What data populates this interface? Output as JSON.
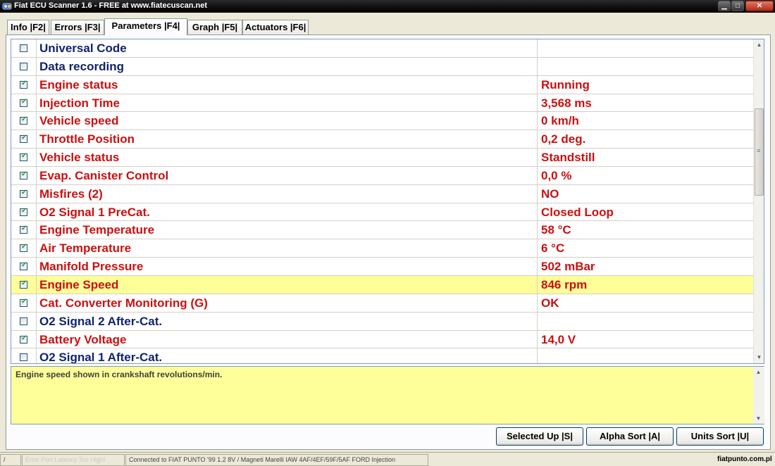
{
  "window": {
    "title": "Fiat ECU Scanner 1.6 - FREE at www.fiatecuscan.net",
    "min_glyph": "▁",
    "max_glyph": "□",
    "close_glyph": "✕"
  },
  "tabs": [
    {
      "label": "Info |F2|",
      "active": false
    },
    {
      "label": "Errors |F3|",
      "active": false
    },
    {
      "label": "Parameters |F4|",
      "active": true
    },
    {
      "label": "Graph |F5|",
      "active": false
    },
    {
      "label": "Actuators |F6|",
      "active": false
    }
  ],
  "parameters": [
    {
      "checked": false,
      "name": "Universal Code",
      "value": ""
    },
    {
      "checked": false,
      "name": "Data recording",
      "value": ""
    },
    {
      "checked": true,
      "name": "Engine status",
      "value": "Running"
    },
    {
      "checked": true,
      "name": "Injection Time",
      "value": "3,568 ms"
    },
    {
      "checked": true,
      "name": "Vehicle speed",
      "value": "0 km/h"
    },
    {
      "checked": true,
      "name": "Throttle Position",
      "value": "0,2 deg."
    },
    {
      "checked": true,
      "name": "Vehicle status",
      "value": "Standstill"
    },
    {
      "checked": true,
      "name": "Evap. Canister Control",
      "value": "0,0 %"
    },
    {
      "checked": true,
      "name": "Misfires (2)",
      "value": "NO"
    },
    {
      "checked": true,
      "name": "O2 Signal 1 PreCat.",
      "value": "Closed Loop"
    },
    {
      "checked": true,
      "name": "Engine Temperature",
      "value": "58 °C"
    },
    {
      "checked": true,
      "name": "Air Temperature",
      "value": "6 °C"
    },
    {
      "checked": true,
      "name": "Manifold Pressure",
      "value": "502 mBar"
    },
    {
      "checked": true,
      "name": "Engine Speed",
      "value": "846 rpm",
      "selected": true
    },
    {
      "checked": true,
      "name": "Cat. Converter Monitoring (G)",
      "value": "OK"
    },
    {
      "checked": false,
      "name": "O2 Signal 2 After-Cat.",
      "value": ""
    },
    {
      "checked": true,
      "name": "Battery Voltage",
      "value": "14,0 V"
    },
    {
      "checked": false,
      "name": "O2 Signal 1 After-Cat.",
      "value": ""
    }
  ],
  "description": "Engine speed shown in crankshaft revolutions/min.",
  "buttons": {
    "selected_up": "Selected Up |S|",
    "alpha_sort": "Alpha Sort |A|",
    "units_sort": "Units Sort |U|"
  },
  "statusbar": {
    "panel1": "/",
    "panel2": "Error Port Latency Too High!",
    "panel3": "Connected to FIAT PUNTO '99 1.2 8V / Magneti Marelli IAW 4AF/4EF/59F/5AF FORD Injection"
  },
  "watermark": "fiatpunto.com.pl",
  "scrollbar": {
    "up_glyph": "▲",
    "down_glyph": "▼",
    "grip_glyph": "≡"
  },
  "colors": {
    "checked_text": "#cc1010",
    "unchecked_text": "#10246e",
    "selected_row": "#ffff99"
  }
}
